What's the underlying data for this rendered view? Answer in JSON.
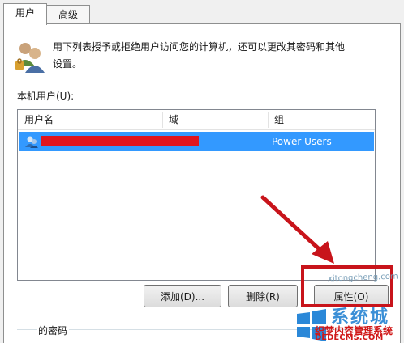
{
  "tabs": [
    {
      "label": "用户",
      "active": true
    },
    {
      "label": "高级",
      "active": false
    }
  ],
  "description": {
    "line1": "用下列表授予或拒绝用户访问您的计算机，还可以更改其密码和其他",
    "line2": "设置。"
  },
  "list": {
    "label": "本机用户(U):",
    "columns": [
      "用户名",
      "域",
      "组"
    ],
    "rows": [
      {
        "group": "Power Users",
        "selected": true,
        "name_redacted": true
      }
    ]
  },
  "buttons": {
    "add": "添加(D)...",
    "remove": "删除(R)",
    "properties": "属性(O)"
  },
  "password_group": {
    "label": "的密码"
  },
  "watermark": {
    "url": "xitongcheng.com",
    "brand": "系统城",
    "cn": "织梦内容管理系统",
    "dede": "DEDECMS.COM"
  },
  "colors": {
    "selection": "#3399ff",
    "redaction": "#e0141e",
    "annotation": "#c8141b"
  }
}
